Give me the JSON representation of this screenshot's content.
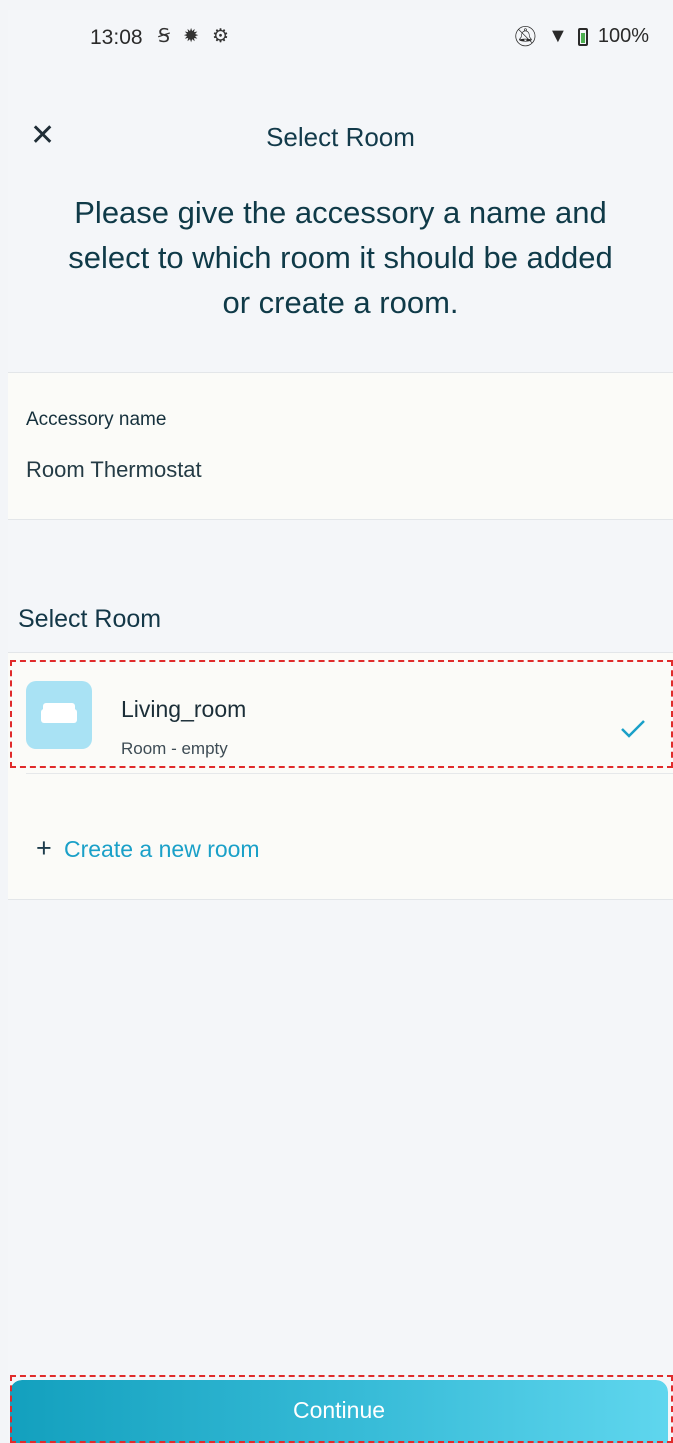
{
  "status_bar": {
    "time": "13:08",
    "left_icons": [
      "s-icon",
      "gear-icon",
      "settings-icon"
    ],
    "battery": "100%"
  },
  "header": {
    "title": "Select Room",
    "close_icon": "close-icon"
  },
  "intro": "Please give the accessory a name and select to which room it should be added or create a room.",
  "accessory": {
    "label": "Accessory name",
    "value": "Room Thermostat"
  },
  "rooms": {
    "section_label": "Select Room",
    "items": [
      {
        "name": "Living_room",
        "subtitle": "Room - empty",
        "selected": true,
        "icon": "sofa-icon"
      }
    ],
    "create_label": "Create a new room"
  },
  "continue_label": "Continue",
  "colors": {
    "accent": "#1aa0c8",
    "button_start": "#13a0be",
    "button_end": "#5fd6ee",
    "highlight": "#e02b2b"
  }
}
